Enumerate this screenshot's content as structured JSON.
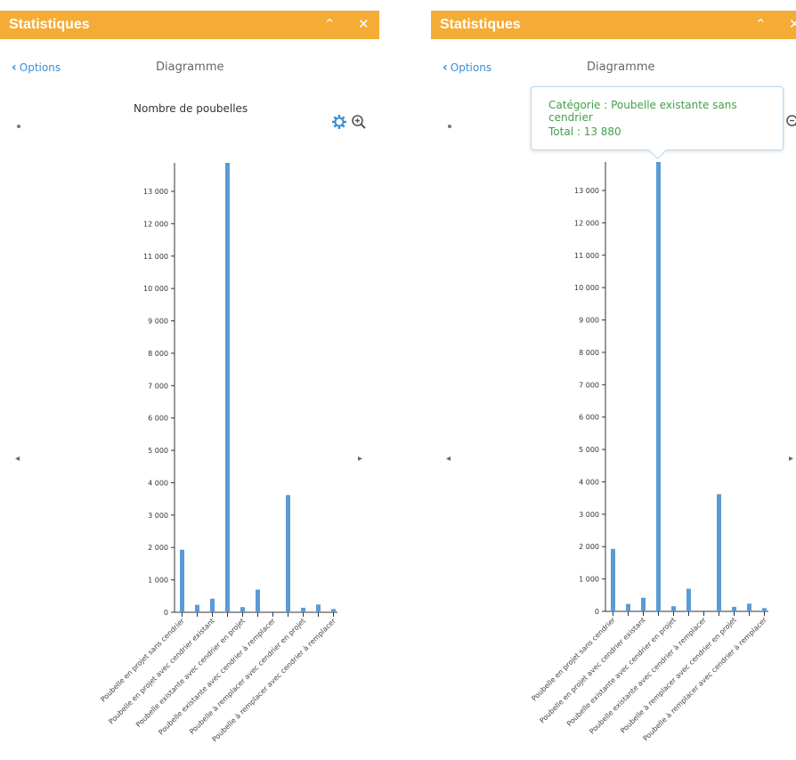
{
  "panel": {
    "title": "Statistiques",
    "collapse_icon": "double-chevron-up-icon",
    "close_icon": "close-icon",
    "back_label": "Options",
    "subtitle": "Diagramme",
    "colors": {
      "header": "#f4ac36",
      "bar": "#5b9bd5",
      "link": "#3a8fd6",
      "tooltip_text": "#43a047"
    }
  },
  "tools": {
    "settings_icon": "gear-icon",
    "zoom_icon": "zoom-in-icon"
  },
  "tooltip": {
    "category": "Catégorie : Poubelle existante sans cendrier",
    "total": "Total : 13 880"
  },
  "chart_data": {
    "type": "bar",
    "title": "Nombre de poubelles",
    "xlabel": "",
    "ylabel": "",
    "ylim": [
      0,
      13880
    ],
    "yticks": [
      0,
      1000,
      2000,
      3000,
      4000,
      5000,
      6000,
      7000,
      8000,
      9000,
      10000,
      11000,
      12000,
      13000
    ],
    "ytick_labels": [
      "0",
      "1 000",
      "2 000",
      "3 000",
      "4 000",
      "5 000",
      "6 000",
      "7 000",
      "8 000",
      "9 000",
      "10 000",
      "11 000",
      "12 000",
      "13 000"
    ],
    "categories": [
      "Poubelle en projet sans cendrier",
      "",
      "Poubelle en projet avec cendrier existant",
      "",
      "Poubelle existante avec cendrier en projet",
      "",
      "Poubelle existante avec cendrier à remplacer",
      "",
      "Poubelle à remplacer avec cendrier en projet",
      "",
      "Poubelle à remplacer avec cendrier à remplacer"
    ],
    "values": [
      1930,
      230,
      420,
      13880,
      160,
      700,
      0,
      3620,
      140,
      240,
      100
    ]
  }
}
